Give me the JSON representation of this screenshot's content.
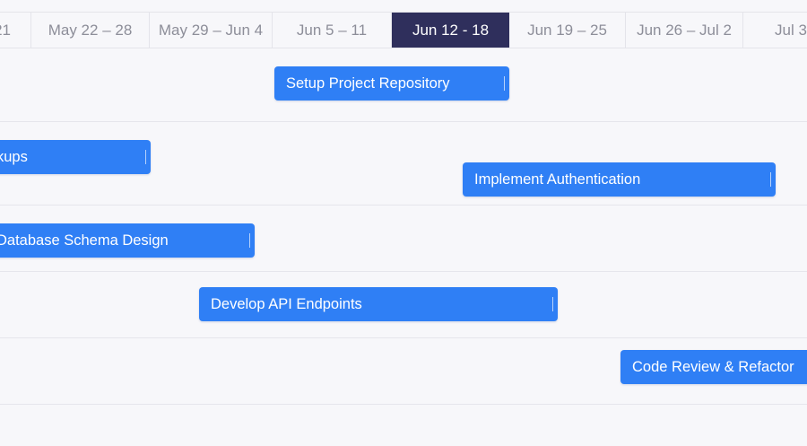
{
  "weeks": [
    {
      "label": "21",
      "current": false
    },
    {
      "label": "May 22 – 28",
      "current": false
    },
    {
      "label": "May 29 – Jun 4",
      "current": false
    },
    {
      "label": "Jun 5 – 11",
      "current": false
    },
    {
      "label": "Jun 12 - 18",
      "current": true
    },
    {
      "label": "Jun 19 – 25",
      "current": false
    },
    {
      "label": "Jun 26 – Jul 2",
      "current": false
    },
    {
      "label": "Jul 3",
      "current": false
    }
  ],
  "tasks": [
    {
      "name": "Setup Project Repository"
    },
    {
      "name": "kups"
    },
    {
      "name": "Implement Authentication"
    },
    {
      "name": "Database Schema Design"
    },
    {
      "name": "Develop API Endpoints"
    },
    {
      "name": "Code Review & Refactor"
    }
  ],
  "colors": {
    "task_bar": "#2f7ff5",
    "current_week": "#2f2f5c",
    "background": "#f7f7fa"
  }
}
